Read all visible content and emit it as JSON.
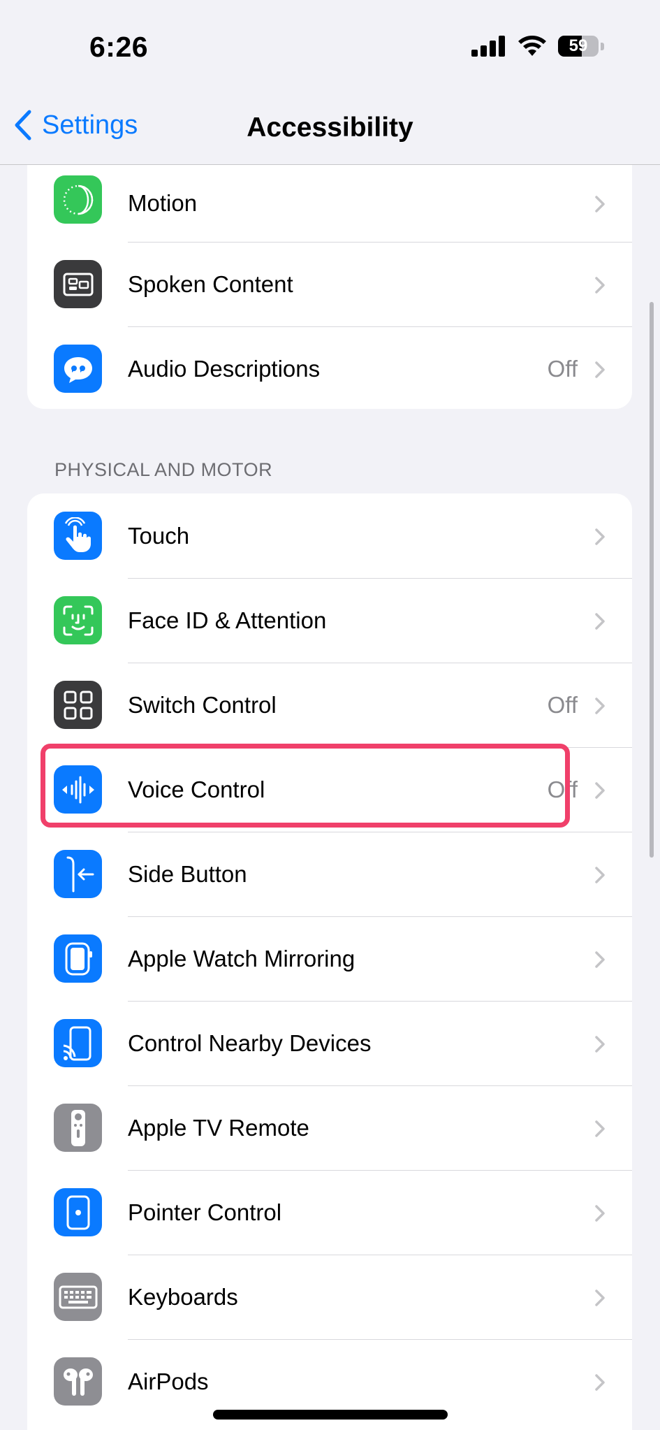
{
  "status_bar": {
    "time": "6:26",
    "battery": "59",
    "battery_level": 0.59
  },
  "nav": {
    "back_label": "Settings",
    "title": "Accessibility"
  },
  "top_group": {
    "items": [
      {
        "label": "Motion",
        "value": "",
        "icon": "motion-icon",
        "color": "#34c759"
      },
      {
        "label": "Spoken Content",
        "value": "",
        "icon": "spoken-content-icon",
        "color": "#3a3a3c"
      },
      {
        "label": "Audio Descriptions",
        "value": "Off",
        "icon": "audio-descriptions-icon",
        "color": "#0a7aff"
      }
    ]
  },
  "physical_and_motor": {
    "header": "PHYSICAL AND MOTOR",
    "items": [
      {
        "label": "Touch",
        "value": "",
        "icon": "touch-icon",
        "color": "#0a7aff"
      },
      {
        "label": "Face ID & Attention",
        "value": "",
        "icon": "face-id-icon",
        "color": "#34c759"
      },
      {
        "label": "Switch Control",
        "value": "Off",
        "icon": "switch-control-icon",
        "color": "#3a3a3c"
      },
      {
        "label": "Voice Control",
        "value": "Off",
        "icon": "voice-control-icon",
        "color": "#0a7aff"
      },
      {
        "label": "Side Button",
        "value": "",
        "icon": "side-button-icon",
        "color": "#0a7aff"
      },
      {
        "label": "Apple Watch Mirroring",
        "value": "",
        "icon": "apple-watch-icon",
        "color": "#0a7aff"
      },
      {
        "label": "Control Nearby Devices",
        "value": "",
        "icon": "nearby-devices-icon",
        "color": "#0a7aff"
      },
      {
        "label": "Apple TV Remote",
        "value": "",
        "icon": "tv-remote-icon",
        "color": "#8e8e93"
      },
      {
        "label": "Pointer Control",
        "value": "",
        "icon": "pointer-control-icon",
        "color": "#0a7aff"
      },
      {
        "label": "Keyboards",
        "value": "",
        "icon": "keyboard-icon",
        "color": "#8e8e93"
      },
      {
        "label": "AirPods",
        "value": "",
        "icon": "airpods-icon",
        "color": "#8e8e93"
      }
    ]
  },
  "colors": {
    "accent": "#0a7aff",
    "highlight": "#f0406a"
  }
}
